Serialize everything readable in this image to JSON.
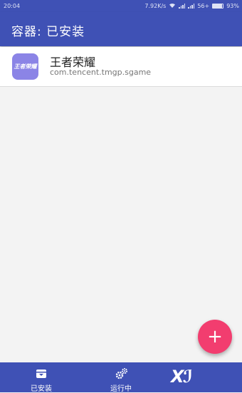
{
  "statusbar": {
    "time": "20:04",
    "net_speed": "7.92K/s",
    "net_type": "56+",
    "battery": "93%",
    "battery_level": 0.93
  },
  "appbar": {
    "title": "容器: 已安装"
  },
  "apps": [
    {
      "name": "王者荣耀",
      "package": "com.tencent.tmgp.sgame",
      "icon_text": "王者荣耀"
    }
  ],
  "fab": {
    "icon": "plus-icon",
    "symbol": "+"
  },
  "bottom_nav": {
    "installed_label": "已安装",
    "running_label": "运行中",
    "logo": "Xℐ"
  },
  "colors": {
    "primary": "#3f51b5",
    "accent": "#f23d6f",
    "app_icon_bg": "#8b84e6"
  }
}
